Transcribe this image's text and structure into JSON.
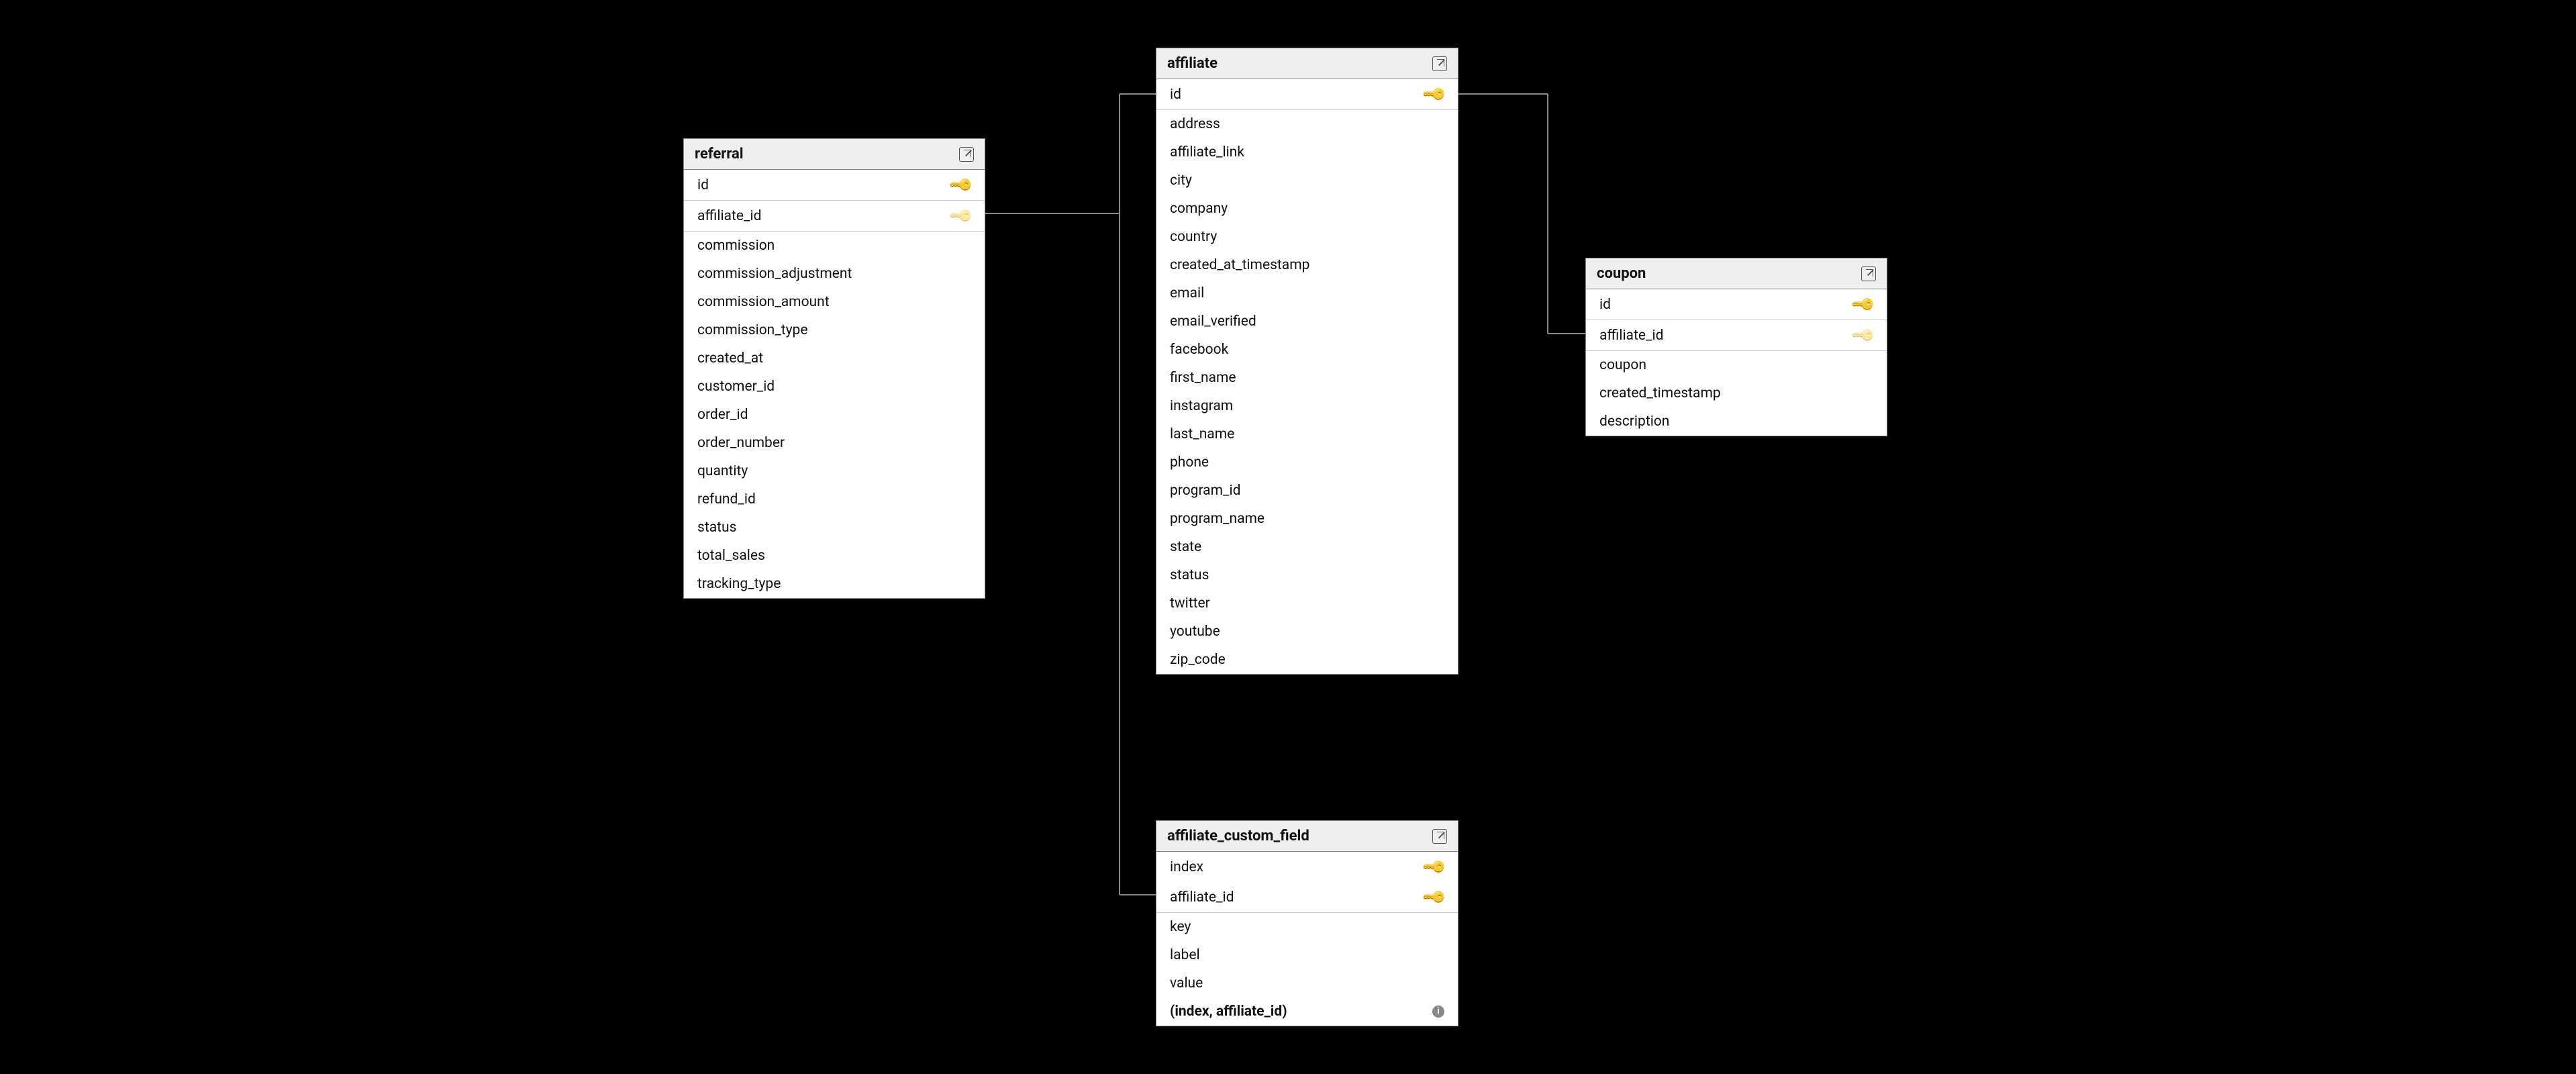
{
  "entities": {
    "referral": {
      "title": "referral",
      "columns": [
        {
          "name": "id",
          "key": "pk",
          "divider": true
        },
        {
          "name": "affiliate_id",
          "key": "fk",
          "divider": true
        },
        {
          "name": "commission"
        },
        {
          "name": "commission_adjustment"
        },
        {
          "name": "commission_amount"
        },
        {
          "name": "commission_type"
        },
        {
          "name": "created_at"
        },
        {
          "name": "customer_id"
        },
        {
          "name": "order_id"
        },
        {
          "name": "order_number"
        },
        {
          "name": "quantity"
        },
        {
          "name": "refund_id"
        },
        {
          "name": "status"
        },
        {
          "name": "total_sales"
        },
        {
          "name": "tracking_type"
        }
      ]
    },
    "affiliate": {
      "title": "affiliate",
      "columns": [
        {
          "name": "id",
          "key": "pk",
          "divider": true
        },
        {
          "name": "address"
        },
        {
          "name": "affiliate_link"
        },
        {
          "name": "city"
        },
        {
          "name": "company"
        },
        {
          "name": "country"
        },
        {
          "name": "created_at_timestamp"
        },
        {
          "name": "email"
        },
        {
          "name": "email_verified"
        },
        {
          "name": "facebook"
        },
        {
          "name": "first_name"
        },
        {
          "name": "instagram"
        },
        {
          "name": "last_name"
        },
        {
          "name": "phone"
        },
        {
          "name": "program_id"
        },
        {
          "name": "program_name"
        },
        {
          "name": "state"
        },
        {
          "name": "status"
        },
        {
          "name": "twitter"
        },
        {
          "name": "youtube"
        },
        {
          "name": "zip_code"
        }
      ]
    },
    "affiliate_custom_field": {
      "title": "affiliate_custom_field",
      "columns": [
        {
          "name": "index",
          "key": "pk"
        },
        {
          "name": "affiliate_id",
          "key": "pk",
          "divider": true
        },
        {
          "name": "key"
        },
        {
          "name": "label"
        },
        {
          "name": "value"
        },
        {
          "name": "(index, affiliate_id)",
          "composite": true,
          "info": true
        }
      ]
    },
    "coupon": {
      "title": "coupon",
      "columns": [
        {
          "name": "id",
          "key": "pk",
          "divider": true
        },
        {
          "name": "affiliate_id",
          "key": "fk",
          "divider": true
        },
        {
          "name": "coupon"
        },
        {
          "name": "created_timestamp"
        },
        {
          "name": "description"
        }
      ]
    }
  }
}
